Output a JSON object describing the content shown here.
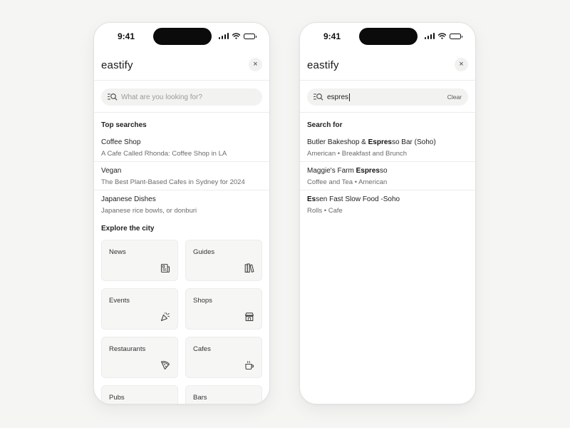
{
  "status_bar": {
    "time": "9:41"
  },
  "app": {
    "logo": "eastify",
    "close_glyph": "×"
  },
  "left_screen": {
    "search": {
      "placeholder": "What are you looking for?"
    },
    "top_searches": {
      "title": "Top searches",
      "items": [
        {
          "title": "Coffee Shop",
          "subtitle": "A Cafe Called Rhonda: Coffee Shop in LA"
        },
        {
          "title": "Vegan",
          "subtitle": "The Best Plant-Based Cafes in Sydney for 2024"
        },
        {
          "title": "Japanese Dishes",
          "subtitle": "Japanese rice bowls, or donburi"
        }
      ]
    },
    "explore": {
      "title": "Explore the city",
      "tiles": [
        {
          "label": "News",
          "icon": "newspaper-icon"
        },
        {
          "label": "Guides",
          "icon": "books-icon"
        },
        {
          "label": "Events",
          "icon": "party-popper-icon"
        },
        {
          "label": "Shops",
          "icon": "storefront-icon"
        },
        {
          "label": "Restaurants",
          "icon": "pizza-slice-icon"
        },
        {
          "label": "Cafes",
          "icon": "coffee-cup-icon"
        },
        {
          "label": "Pubs",
          "icon": ""
        },
        {
          "label": "Bars",
          "icon": ""
        }
      ]
    }
  },
  "right_screen": {
    "search": {
      "value": "espres",
      "clear_label": "Clear"
    },
    "results": {
      "title": "Search for",
      "items": [
        {
          "pre": "Butler Bakeshop & ",
          "match": "Espres",
          "post": "so Bar (Soho)",
          "subtitle": "American • Breakfast and Brunch"
        },
        {
          "pre": "Maggie's Farm ",
          "match": "Espres",
          "post": "so",
          "subtitle": "Coffee and Tea • American"
        },
        {
          "pre": "",
          "match": "Es",
          "post": "sen Fast Slow Food -Soho",
          "subtitle": "Rolls • Cafe"
        }
      ]
    }
  },
  "colors": {
    "background": "#f5f5f4",
    "card": "#ffffff",
    "search_fill": "#f2f2f0",
    "tile_fill": "#f6f6f5",
    "text": "#222222",
    "muted": "#6b6b69"
  }
}
